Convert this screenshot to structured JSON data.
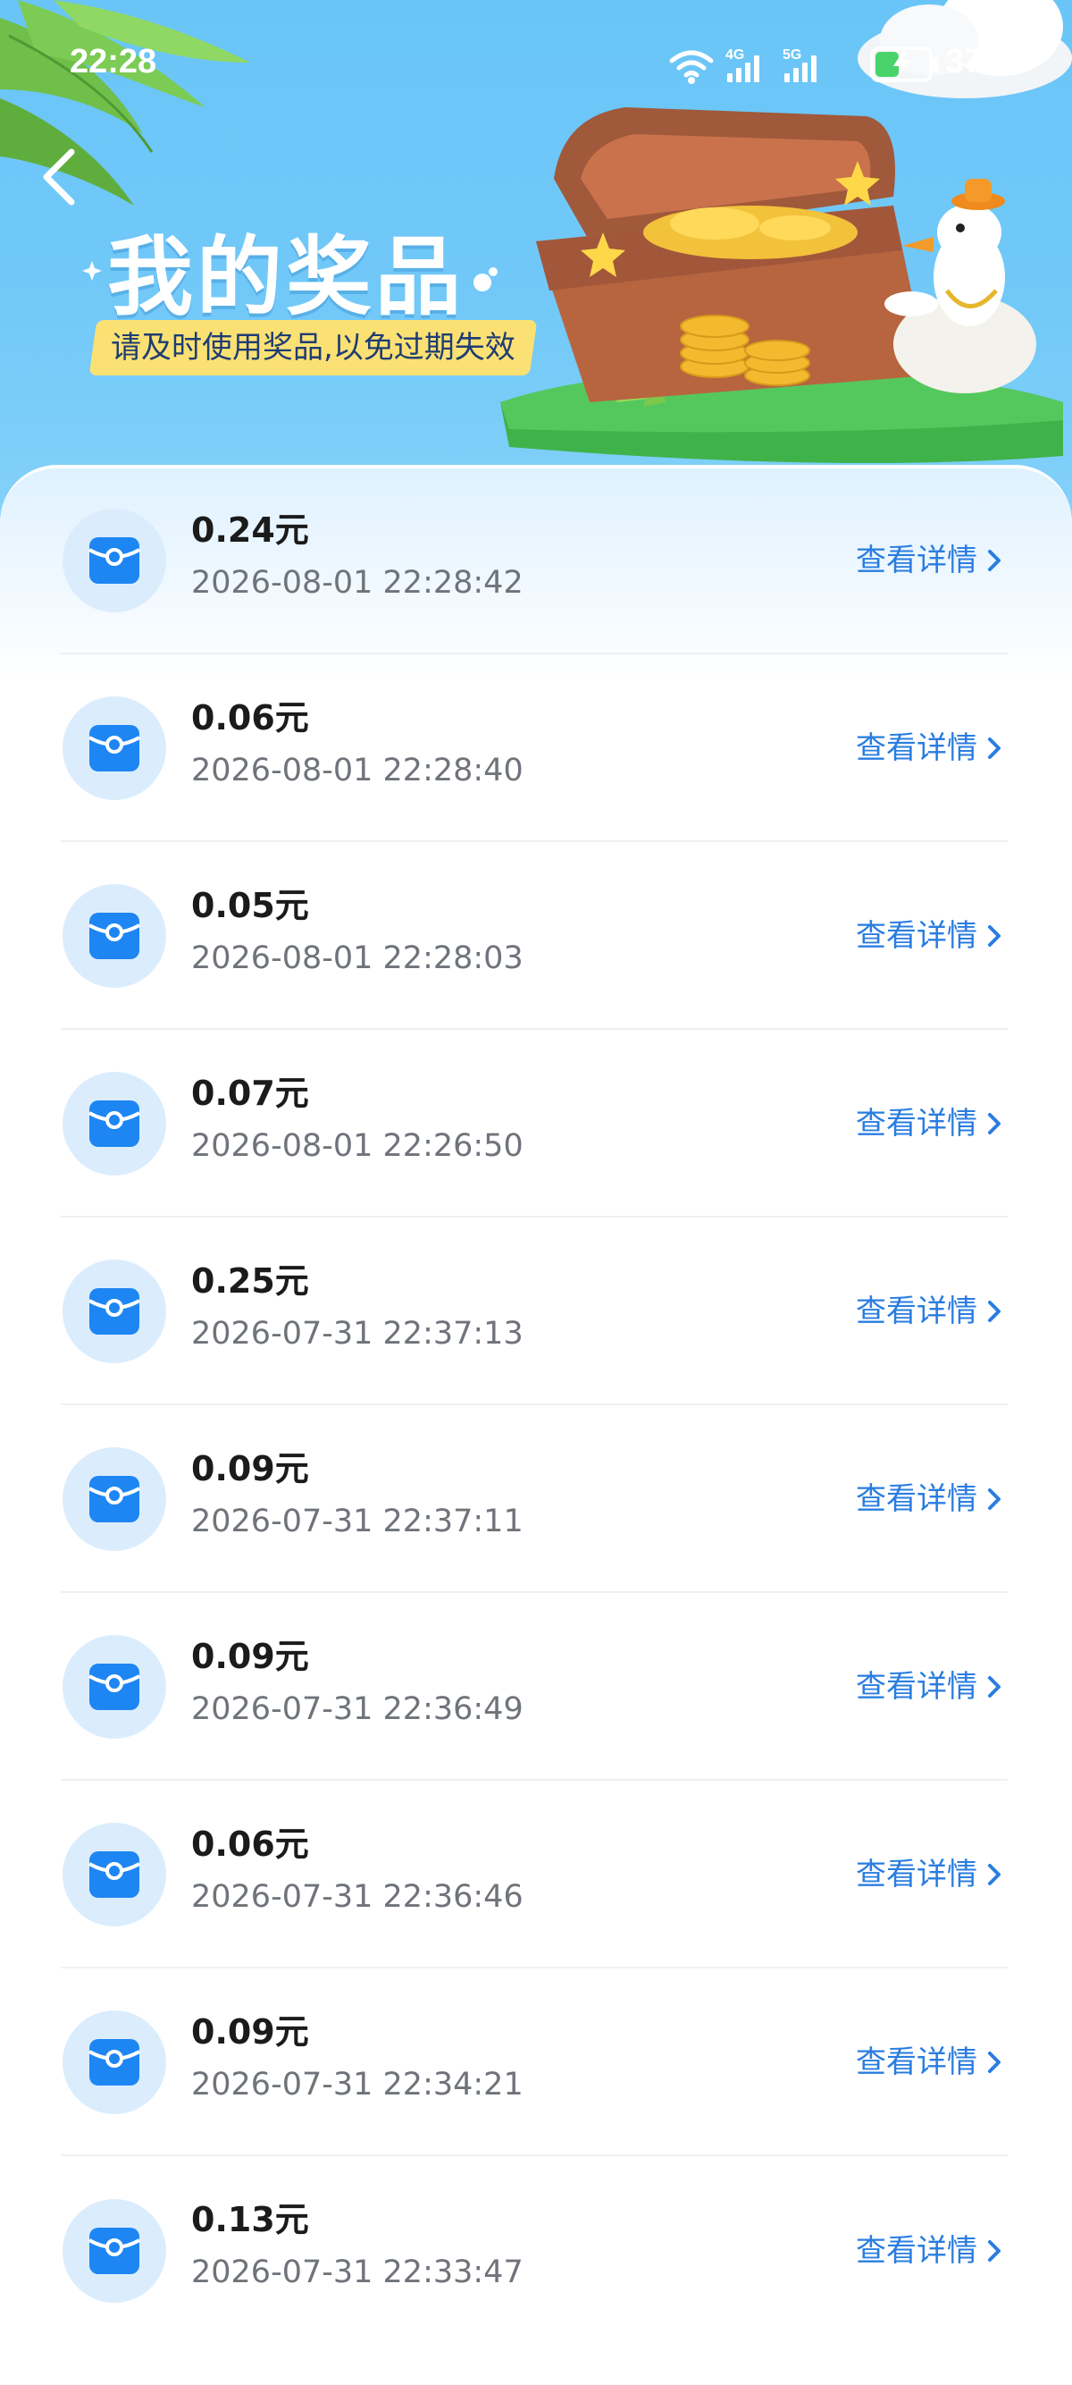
{
  "status_bar": {
    "time": "22:28",
    "network_1": "4G",
    "network_2": "5G",
    "battery": "37%"
  },
  "header": {
    "title": "我的奖品",
    "subtitle": "请及时使用奖品,以免过期失效"
  },
  "prizes": [
    {
      "amount": "0.24元",
      "date": "2026-08-01 22:28:42",
      "action": "查看详情"
    },
    {
      "amount": "0.06元",
      "date": "2026-08-01 22:28:40",
      "action": "查看详情"
    },
    {
      "amount": "0.05元",
      "date": "2026-08-01 22:28:03",
      "action": "查看详情"
    },
    {
      "amount": "0.07元",
      "date": "2026-08-01 22:26:50",
      "action": "查看详情"
    },
    {
      "amount": "0.25元",
      "date": "2026-07-31 22:37:13",
      "action": "查看详情"
    },
    {
      "amount": "0.09元",
      "date": "2026-07-31 22:37:11",
      "action": "查看详情"
    },
    {
      "amount": "0.09元",
      "date": "2026-07-31 22:36:49",
      "action": "查看详情"
    },
    {
      "amount": "0.06元",
      "date": "2026-07-31 22:36:46",
      "action": "查看详情"
    },
    {
      "amount": "0.09元",
      "date": "2026-07-31 22:34:21",
      "action": "查看详情"
    },
    {
      "amount": "0.13元",
      "date": "2026-07-31 22:33:47",
      "action": "查看详情"
    }
  ],
  "colors": {
    "sky": "#69c5f7",
    "accent": "#2a7de0",
    "icon_bg": "#dbedfd",
    "badge": "#fbe173"
  },
  "icons": {
    "back": "chevron-left-icon",
    "prize": "red-packet-icon",
    "detail": "chevron-right-icon"
  }
}
